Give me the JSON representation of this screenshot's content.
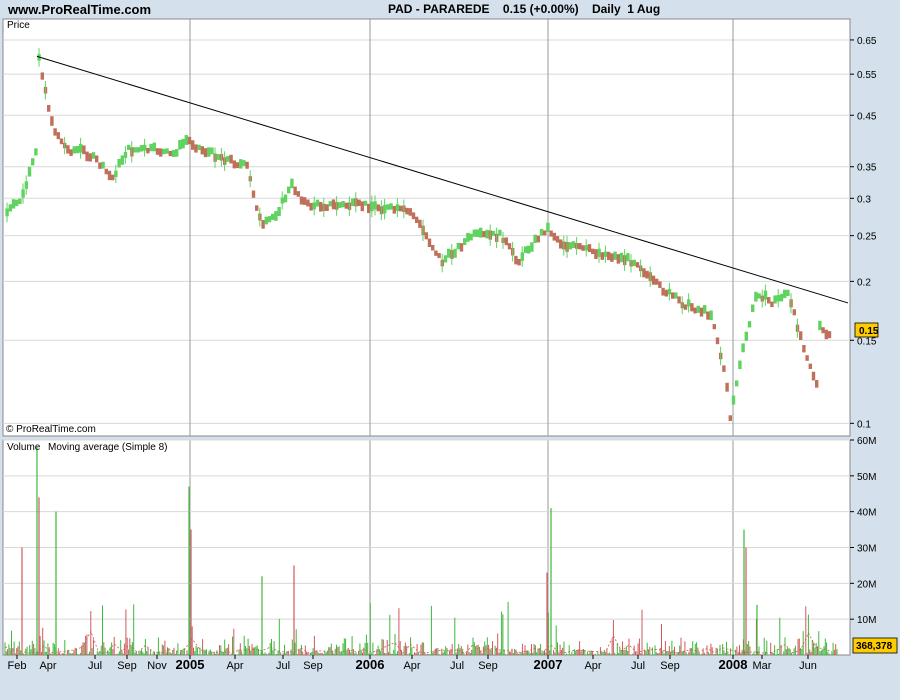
{
  "header": {
    "site": "www.ProRealTime.com",
    "title": "PAD - PARAREDE    0.15 (+0.00%)    Daily  1 Aug"
  },
  "colors": {
    "background": "#d4e0eb",
    "panel": "#ffffff",
    "grid": "#d8d8d8",
    "up": "#5fd35f",
    "down": "#c0705a",
    "volume_green": "#3cb83c",
    "volume_red": "#d05a5a",
    "badge": "#ffcc00"
  },
  "chart_data": [
    {
      "type": "candlestick",
      "title": "Price",
      "watermark": "© ProRealTime.com",
      "scale": "log",
      "ylim": [
        0.094,
        0.72
      ],
      "y_ticks": [
        0.1,
        0.15,
        0.2,
        0.25,
        0.3,
        0.35,
        0.45,
        0.55,
        0.65
      ],
      "last_price_label": "0.15",
      "x_ticks": [
        "Feb",
        "Apr",
        "Jul",
        "Sep",
        "Nov",
        "2005",
        "Apr",
        "Jul",
        "Sep",
        "2006",
        "Apr",
        "Jul",
        "Sep",
        "2007",
        "Apr",
        "Jul",
        "Sep",
        "2008",
        "Mar",
        "Jun"
      ],
      "x_ticks_bold": [
        false,
        false,
        false,
        false,
        false,
        true,
        false,
        false,
        false,
        true,
        false,
        false,
        false,
        true,
        false,
        false,
        false,
        true,
        false,
        false
      ],
      "trendline": {
        "from": {
          "x": "Mar 2004",
          "y": 0.6
        },
        "to": {
          "x": "Aug 2008",
          "y": 0.18
        }
      },
      "price_path": [
        {
          "x": "Jan 2004",
          "y": 0.28
        },
        {
          "x": "Feb 2004",
          "y": 0.3
        },
        {
          "x": "Mar 2004",
          "y": 0.38
        },
        {
          "x": "Mar 2004",
          "y": 0.6
        },
        {
          "x": "Apr 2004",
          "y": 0.43
        },
        {
          "x": "May 2004",
          "y": 0.38
        },
        {
          "x": "Jun 2004",
          "y": 0.38
        },
        {
          "x": "Jul 2004",
          "y": 0.36
        },
        {
          "x": "Aug 2004",
          "y": 0.33
        },
        {
          "x": "Sep 2004",
          "y": 0.38
        },
        {
          "x": "Nov 2004",
          "y": 0.38
        },
        {
          "x": "Dec 2004",
          "y": 0.37
        },
        {
          "x": "Jan 2005",
          "y": 0.4
        },
        {
          "x": "Feb 2005",
          "y": 0.38
        },
        {
          "x": "May 2005",
          "y": 0.35
        },
        {
          "x": "Jun 2005",
          "y": 0.26
        },
        {
          "x": "Jul 2005",
          "y": 0.28
        },
        {
          "x": "Aug 2005",
          "y": 0.32
        },
        {
          "x": "Sep 2005",
          "y": 0.29
        },
        {
          "x": "Jan 2006",
          "y": 0.29
        },
        {
          "x": "Apr 2006",
          "y": 0.28
        },
        {
          "x": "Jun 2006",
          "y": 0.22
        },
        {
          "x": "Aug 2006",
          "y": 0.25
        },
        {
          "x": "Oct 2006",
          "y": 0.25
        },
        {
          "x": "Nov 2006",
          "y": 0.22
        },
        {
          "x": "Dec 2006",
          "y": 0.24
        },
        {
          "x": "Jan 2007",
          "y": 0.26
        },
        {
          "x": "Feb 2007",
          "y": 0.24
        },
        {
          "x": "Jul 2007",
          "y": 0.22
        },
        {
          "x": "Aug 2007",
          "y": 0.2
        },
        {
          "x": "Oct 2007",
          "y": 0.18
        },
        {
          "x": "Dec 2007",
          "y": 0.17
        },
        {
          "x": "Jan 2008",
          "y": 0.12
        },
        {
          "x": "Jan 2008",
          "y": 0.1
        },
        {
          "x": "Feb 2008",
          "y": 0.14
        },
        {
          "x": "Mar 2008",
          "y": 0.19
        },
        {
          "x": "Apr 2008",
          "y": 0.18
        },
        {
          "x": "May 2008",
          "y": 0.19
        },
        {
          "x": "Jun 2008",
          "y": 0.15
        },
        {
          "x": "Jul 2008",
          "y": 0.12
        },
        {
          "x": "Jul 2008",
          "y": 0.16
        },
        {
          "x": "Aug 2008",
          "y": 0.15
        }
      ]
    },
    {
      "type": "bar",
      "title": "Volume",
      "subtitle": "Moving average (Simple 8)",
      "ylim": [
        0,
        60000000
      ],
      "y_ticks": [
        "10M",
        "20M",
        "30M",
        "40M",
        "50M",
        "60M"
      ],
      "last_volume_label": "368,378",
      "spikes": [
        {
          "x": "Mar 2004",
          "value": 58000000
        },
        {
          "x": "Mar 2004",
          "value": 44000000
        },
        {
          "x": "Apr 2004",
          "value": 40000000
        },
        {
          "x": "Feb 2004",
          "value": 30000000
        },
        {
          "x": "Jan 2005",
          "value": 47000000
        },
        {
          "x": "Jan 2005",
          "value": 35000000
        },
        {
          "x": "Jun 2005",
          "value": 22000000
        },
        {
          "x": "Aug 2005",
          "value": 25000000
        },
        {
          "x": "Jan 2007",
          "value": 41000000
        },
        {
          "x": "Jan 2007",
          "value": 23000000
        },
        {
          "x": "Feb 2008",
          "value": 35000000
        },
        {
          "x": "Feb 2008",
          "value": 30000000
        },
        {
          "x": "Mar 2008",
          "value": 14000000
        }
      ]
    }
  ]
}
